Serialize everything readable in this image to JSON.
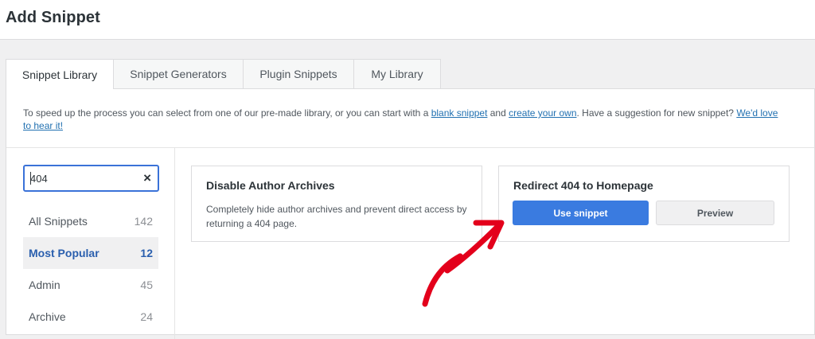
{
  "header": {
    "title": "Add Snippet"
  },
  "tabs": [
    {
      "label": "Snippet Library",
      "active": true
    },
    {
      "label": "Snippet Generators"
    },
    {
      "label": "Plugin Snippets"
    },
    {
      "label": "My Library"
    }
  ],
  "intro": {
    "text_before": "To speed up the process you can select from one of our pre-made library, or you can start with a ",
    "link1": "blank snippet",
    "text_mid": " and ",
    "link2": "create your own",
    "text_after": ". Have a suggestion for new snippet? ",
    "link3": "We'd love to hear it!"
  },
  "search": {
    "value": "404",
    "clear_icon": "×"
  },
  "categories": [
    {
      "label": "All Snippets",
      "count": "142"
    },
    {
      "label": "Most Popular",
      "count": "12",
      "active": true
    },
    {
      "label": "Admin",
      "count": "45"
    },
    {
      "label": "Archive",
      "count": "24"
    }
  ],
  "cards": [
    {
      "title": "Disable Author Archives",
      "description": "Completely hide author archives and prevent direct access by returning a 404 page."
    },
    {
      "title": "Redirect 404 to Homepage",
      "use_label": "Use snippet",
      "preview_label": "Preview"
    }
  ],
  "colors": {
    "accent": "#3a7be0",
    "arrow": "#e3001b",
    "link": "#2271b1"
  }
}
